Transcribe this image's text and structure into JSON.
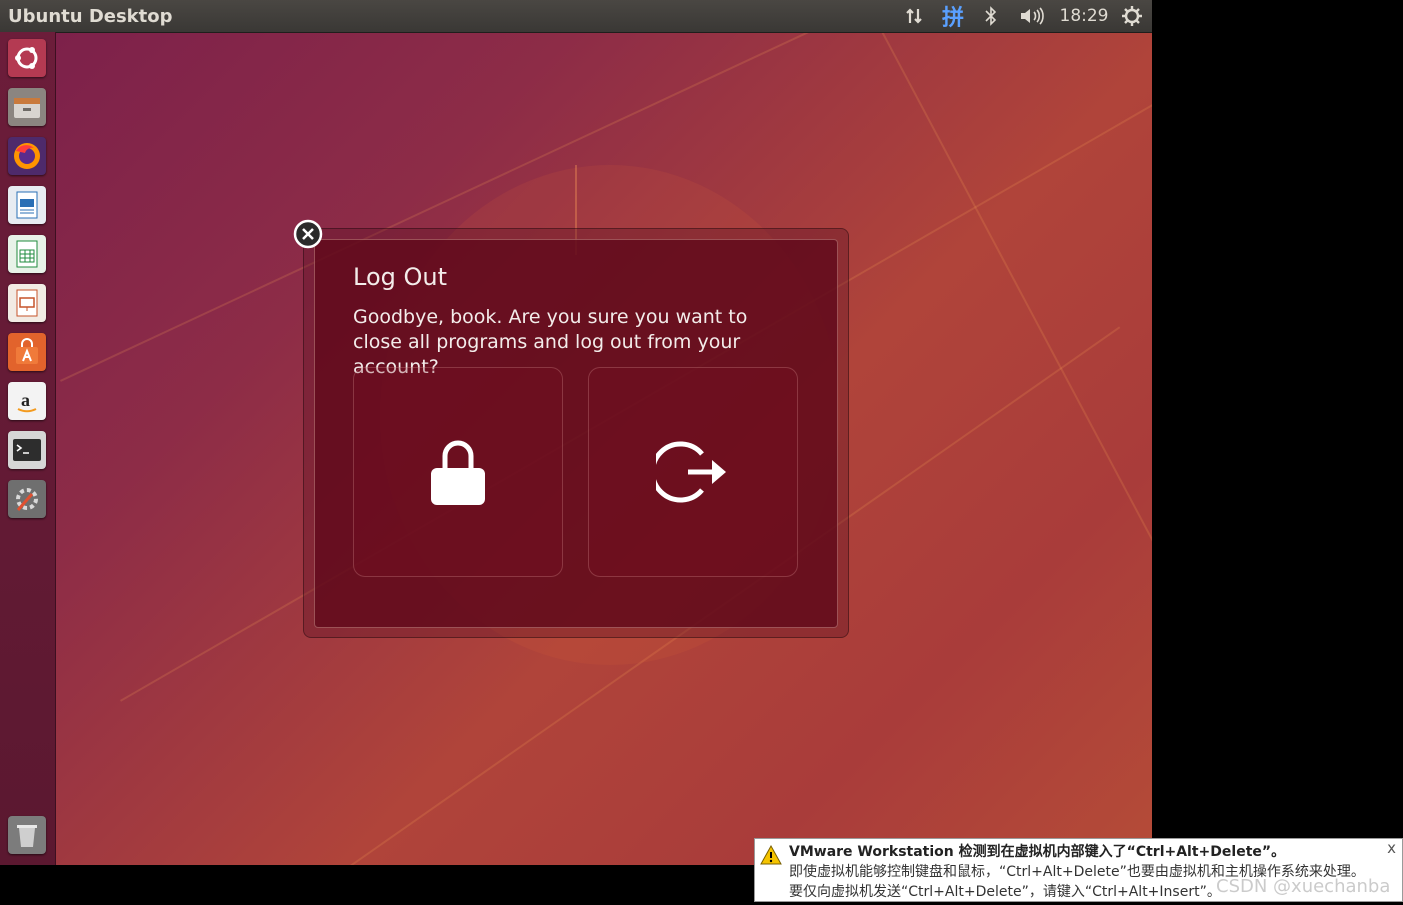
{
  "topbar": {
    "title": "Ubuntu Desktop",
    "indicators": {
      "network_icon": "network-transfer-icon",
      "input_method": "拼",
      "bluetooth_icon": "bluetooth-icon",
      "volume_icon": "volume-icon",
      "clock": "18:29",
      "power_icon": "gear-power-icon"
    }
  },
  "launcher": {
    "items": [
      {
        "name": "dash-home"
      },
      {
        "name": "files"
      },
      {
        "name": "firefox"
      },
      {
        "name": "libreoffice-writer"
      },
      {
        "name": "libreoffice-calc"
      },
      {
        "name": "libreoffice-impress"
      },
      {
        "name": "ubuntu-software"
      },
      {
        "name": "amazon"
      },
      {
        "name": "terminal"
      },
      {
        "name": "system-settings"
      },
      {
        "name": "trash"
      }
    ]
  },
  "dialog": {
    "title": "Log Out",
    "message": "Goodbye, book. Are you sure you want to close all programs and log out from your account?",
    "actions": [
      {
        "icon": "lock-icon"
      },
      {
        "icon": "logout-icon"
      }
    ]
  },
  "toast": {
    "line1": "VMware Workstation 检测到在虚拟机内部键入了“Ctrl+Alt+Delete”。",
    "line2": "即使虚拟机能够控制键盘和鼠标，“Ctrl+Alt+Delete”也要由虚拟机和主机操作系统来处理。",
    "line3": "要仅向虚拟机发送“Ctrl+Alt+Delete”，请键入“Ctrl+Alt+Insert”。",
    "close": "x",
    "warning_color": "#f5c400"
  },
  "watermark": "CSDN @xuechanba"
}
